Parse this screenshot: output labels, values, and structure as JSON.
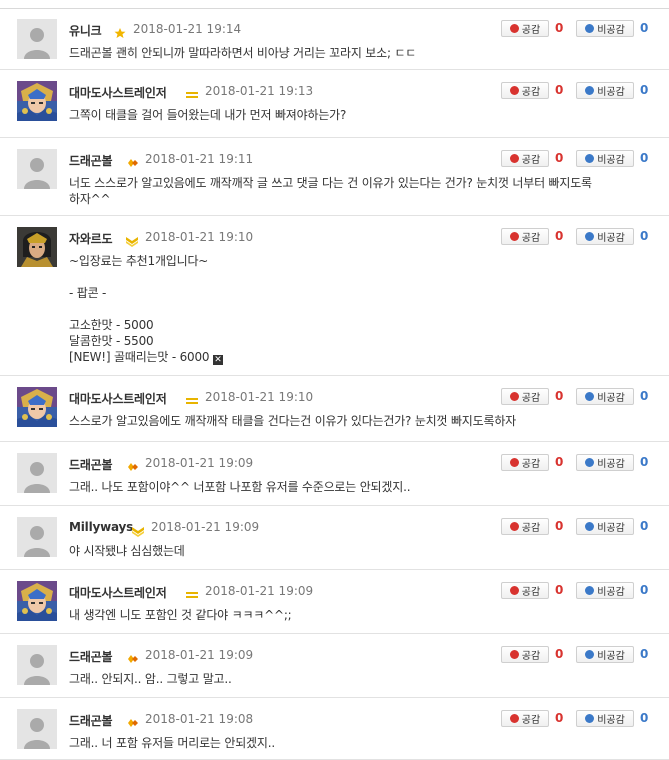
{
  "ui": {
    "like_label": "공감",
    "dislike_label": "비공감",
    "x_mark": "✕"
  },
  "comments": [
    {
      "author": "유니크",
      "badge": "star",
      "avatar": "default",
      "date": "2018-01-21 19:14",
      "likes": "0",
      "dislikes": "0",
      "lines": [
        "드래곤볼 괜히 안되니까 말따라하면서 비아냥 거리는 꼬라지 보소; ㄷㄷ"
      ]
    },
    {
      "author": "대마도사스트레인저",
      "badge": "bar",
      "avatar": "knight",
      "date": "2018-01-21 19:13",
      "likes": "0",
      "dislikes": "0",
      "lines": [
        "그쪽이 태클을 걸어 들어왔는데 내가 먼저 빠져야하는가?"
      ]
    },
    {
      "author": "드래곤볼",
      "badge": "diamond",
      "avatar": "default",
      "date": "2018-01-21 19:11",
      "likes": "0",
      "dislikes": "0",
      "lines": [
        "너도 스스로가 알고있음에도 깨작깨작 글 쓰고 댓글 다는 건 이유가 있는다는 건가? 눈치껏 너부터 빠지도록",
        "하자^^"
      ]
    },
    {
      "author": "자와르도",
      "badge": "chevron",
      "avatar": "warrior",
      "date": "2018-01-21 19:10",
      "likes": "0",
      "dislikes": "0",
      "lines": [
        "~입장료는 추천1개입니다~",
        "",
        "- 팝콘 -",
        "",
        "고소한맛 - 5000",
        "달콤한맛 - 5500",
        "[NEW!] 골때리는맛 - 6000"
      ]
    },
    {
      "author": "대마도사스트레인저",
      "badge": "bar",
      "avatar": "knight",
      "date": "2018-01-21 19:10",
      "likes": "0",
      "dislikes": "0",
      "lines": [
        "스스로가 알고있음에도 깨작깨작 태클을 건다는건 이유가 있다는건가? 눈치껏 빠지도록하자"
      ]
    },
    {
      "author": "드래곤볼",
      "badge": "diamond",
      "avatar": "default",
      "date": "2018-01-21 19:09",
      "likes": "0",
      "dislikes": "0",
      "lines": [
        "그래.. 나도 포함이야^^ 너포함 나포함 유저를 수준으로는 안되겠지.."
      ]
    },
    {
      "author": "Millyways",
      "badge": "chevron",
      "avatar": "default",
      "date": "2018-01-21 19:09",
      "likes": "0",
      "dislikes": "0",
      "lines": [
        "야 시작됐냐 심심했는데"
      ]
    },
    {
      "author": "대마도사스트레인저",
      "badge": "bar",
      "avatar": "knight",
      "date": "2018-01-21 19:09",
      "likes": "0",
      "dislikes": "0",
      "lines": [
        "내 생각엔 니도 포함인 것 같다야 ㅋㅋㅋ^^;;"
      ]
    },
    {
      "author": "드래곤볼",
      "badge": "diamond",
      "avatar": "default",
      "date": "2018-01-21 19:09",
      "likes": "0",
      "dislikes": "0",
      "lines": [
        "그래.. 안되지.. 암.. 그렇고 말고.."
      ]
    },
    {
      "author": "드래곤볼",
      "badge": "diamond",
      "avatar": "default",
      "date": "2018-01-21 19:08",
      "likes": "0",
      "dislikes": "0",
      "lines": [
        "그래.. 너 포함 유저들 머리로는 안되겠지.."
      ]
    }
  ]
}
